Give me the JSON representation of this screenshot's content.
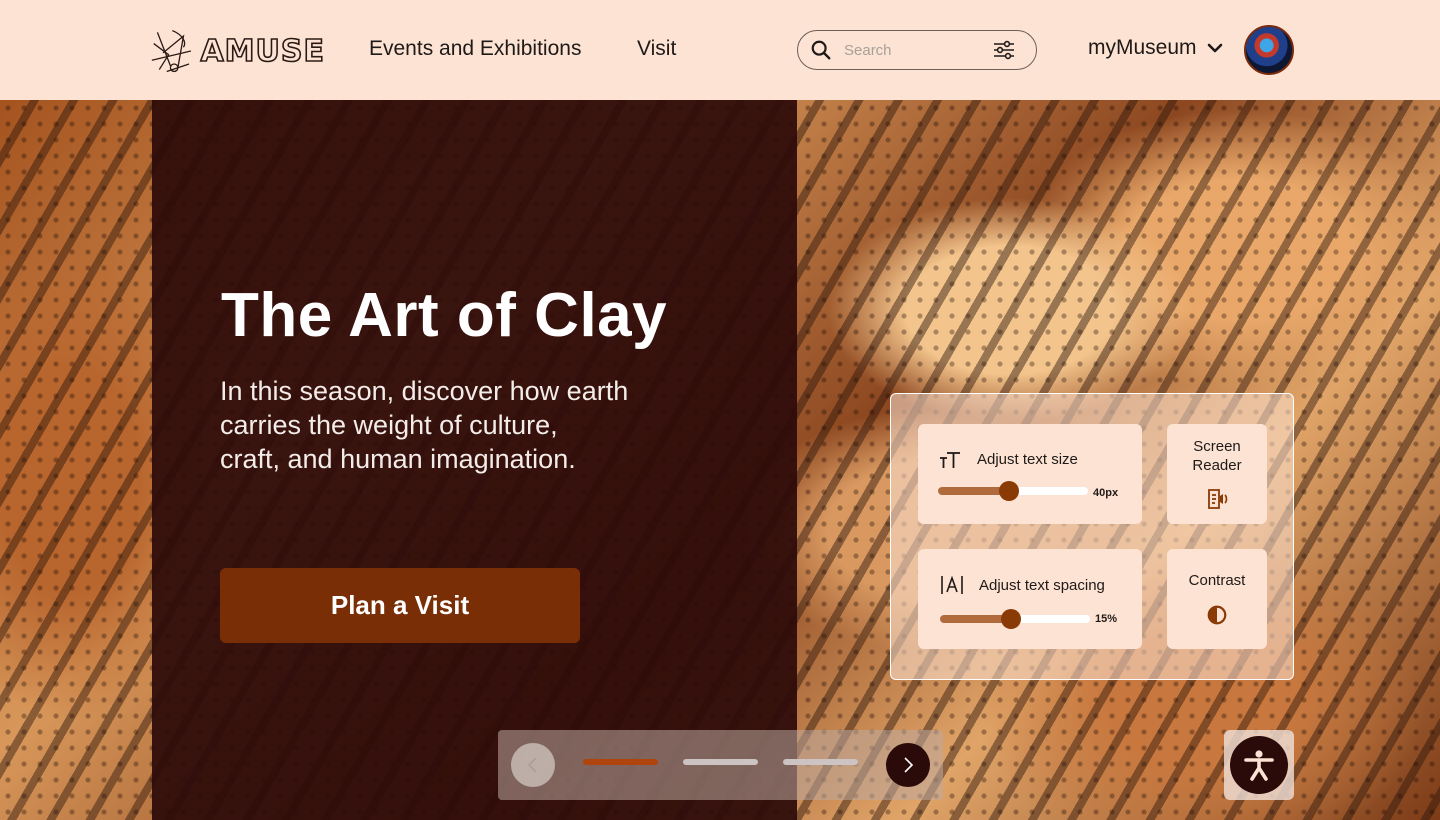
{
  "header": {
    "brand": "AMUSE",
    "nav": [
      {
        "label": "Events and Exhibitions"
      },
      {
        "label": "Visit"
      }
    ],
    "search": {
      "placeholder": "Search",
      "value": ""
    },
    "account_label": "myMuseum"
  },
  "hero": {
    "title": "The Art of Clay",
    "subtitle_lines": [
      "In this season, discover how earth",
      "carries the weight of culture,",
      "craft, and human imagination."
    ],
    "cta_label": "Plan a Visit"
  },
  "accessibility": {
    "text_size": {
      "label": "Adjust text size",
      "value_label": "40px",
      "level": 0.47
    },
    "text_spacing": {
      "label": "Adjust text spacing",
      "value_label": "15%",
      "level": 0.47
    },
    "screen_reader": {
      "label_lines": [
        "Screen",
        "Reader"
      ]
    },
    "contrast": {
      "label": "Contrast"
    }
  },
  "carousel": {
    "slide_count": 3,
    "active_index": 0
  },
  "colors": {
    "header_bg": "#fde3d4",
    "panel_bg": "#2d0b0a",
    "accent": "#7a2e06",
    "active_indicator": "#b0440d"
  }
}
